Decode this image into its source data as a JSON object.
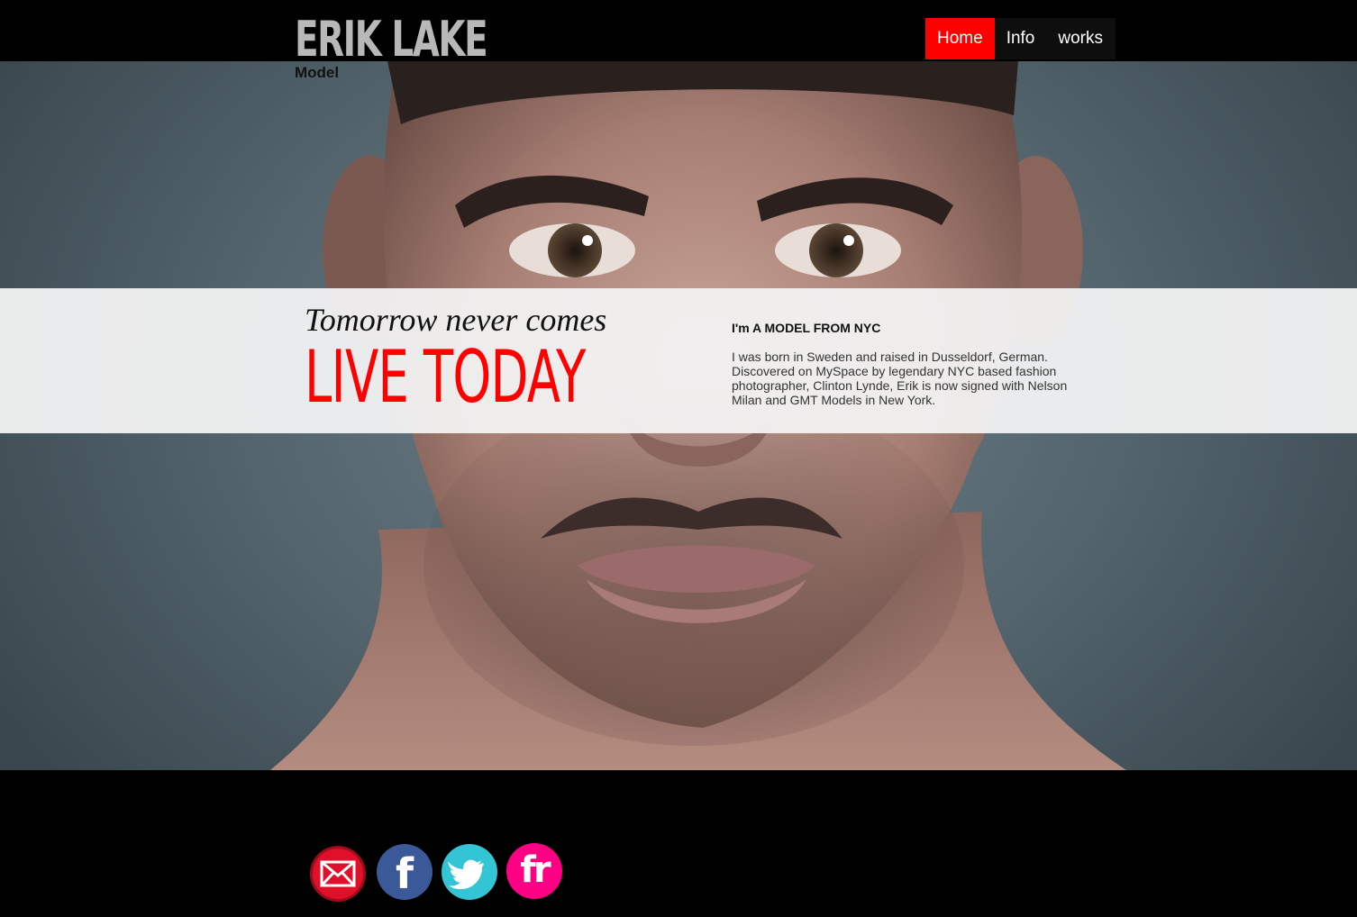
{
  "brand": {
    "name": "ERIK LAKE",
    "tagline": "Model"
  },
  "nav": {
    "items": [
      "Home",
      "Info",
      "works"
    ],
    "active": "Home"
  },
  "hero": {
    "tagline": "Tomorrow never comes",
    "headline": "LIVE TODAY",
    "intro_title": "I'm A MODEL FROM NYC",
    "intro_body": "I was born in Sweden and raised in Dusseldorf, German. Discovered on MySpace by legendary NYC based fashion photographer, Clinton Lynde, Erik is now signed with Nelson Milan and GMT Models in New York."
  },
  "social": [
    {
      "name": "email",
      "icon": "mail-icon",
      "color": "#e0102a"
    },
    {
      "name": "facebook",
      "icon": "facebook-icon",
      "color": "#3b5998",
      "glyph": "f"
    },
    {
      "name": "twitter",
      "icon": "twitter-icon",
      "color": "#33c5d6"
    },
    {
      "name": "flickr",
      "icon": "flickr-icon",
      "color": "#ff0084",
      "glyph": "fr"
    }
  ],
  "colors": {
    "accent": "#ff0000",
    "band": "#f2f2f2",
    "background": "#000000"
  }
}
